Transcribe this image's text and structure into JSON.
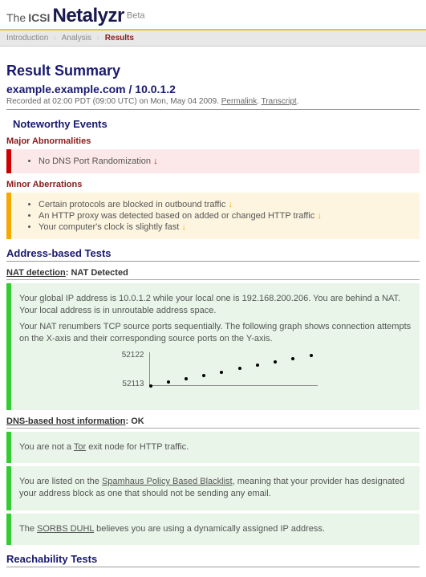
{
  "header": {
    "the": "The",
    "icsi": "ICSI",
    "app": "Netalyzr",
    "beta": "Beta"
  },
  "breadcrumb": {
    "items": [
      "Introduction",
      "Analysis",
      "Results"
    ],
    "current": 2
  },
  "summary": {
    "title": "Result Summary",
    "client": "example.example.com / 10.0.1.2",
    "recorded_prefix": "Recorded at 02:00 PDT (09:00 UTC) on Mon, May 04 2009. ",
    "permalink": "Permalink",
    "transcript": "Transcript"
  },
  "noteworthy": {
    "title": "Noteworthy Events",
    "major": {
      "title": "Major Abnormalities",
      "items": [
        "No DNS Port Randomization"
      ]
    },
    "minor": {
      "title": "Minor Aberrations",
      "items": [
        "Certain protocols are blocked in outbound traffic",
        "An HTTP proxy was detected based on added or changed HTTP traffic",
        "Your computer's clock is slightly fast"
      ]
    }
  },
  "address": {
    "title": "Address-based Tests",
    "nat": {
      "name": "NAT detection",
      "value": "NAT Detected",
      "p1": "Your global IP address is 10.0.1.2 while your local one is 192.168.200.206. You are behind a NAT. Your local address is in unroutable address space.",
      "p2": "Your NAT renumbers TCP source ports sequentially. The following graph shows connection attempts on the X-axis and their corresponding source ports on the Y-axis."
    },
    "dns": {
      "name": "DNS-based host information",
      "value": "OK",
      "p1_a": "You are not a ",
      "p1_link": "Tor",
      "p1_b": " exit node for HTTP traffic.",
      "p2_a": "You are listed on the ",
      "p2_link": "Spamhaus Policy Based Blacklist",
      "p2_b": ", meaning that your provider has designated your address block as one that should not be sending any email.",
      "p3_a": "The ",
      "p3_link": "SORBS DUHL",
      "p3_b": " believes you are using a dynamically assigned IP address."
    }
  },
  "reach": {
    "title": "Reachability Tests"
  },
  "chart_data": {
    "type": "scatter",
    "title": "",
    "xlabel": "",
    "ylabel": "",
    "ylim": [
      52113,
      52122
    ],
    "yticks": [
      52113,
      52122
    ],
    "x": [
      1,
      2,
      3,
      4,
      5,
      6,
      7,
      8,
      9,
      10
    ],
    "values": [
      52113,
      52114,
      52115,
      52116,
      52117,
      52118,
      52119,
      52120,
      52121,
      52122
    ]
  }
}
